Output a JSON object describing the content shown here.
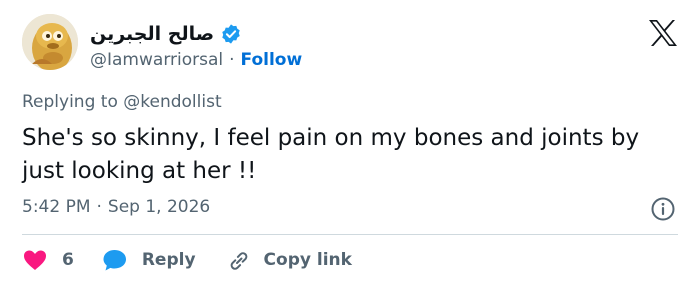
{
  "author": {
    "display_name": "صالح الجبرين",
    "handle": "@Iamwarriorsal",
    "separator": "·",
    "follow_label": "Follow",
    "verified_color": "#1d9bf0",
    "avatar_icon": "cartoon-character-avatar"
  },
  "reply_context": {
    "prefix": "Replying to",
    "mention": "@kendollist"
  },
  "tweet": {
    "text": "She's so skinny, I feel pain on my bones and joints by just looking at her !!",
    "time": "5:42 PM",
    "separator": "·",
    "date": "Sep 1, 2026"
  },
  "actions": {
    "like_count": "6",
    "reply_label": "Reply",
    "copy_link_label": "Copy link"
  },
  "colors": {
    "like": "#f91880",
    "reply": "#1d9bf0",
    "link": "#006fd6",
    "muted": "#536471"
  }
}
